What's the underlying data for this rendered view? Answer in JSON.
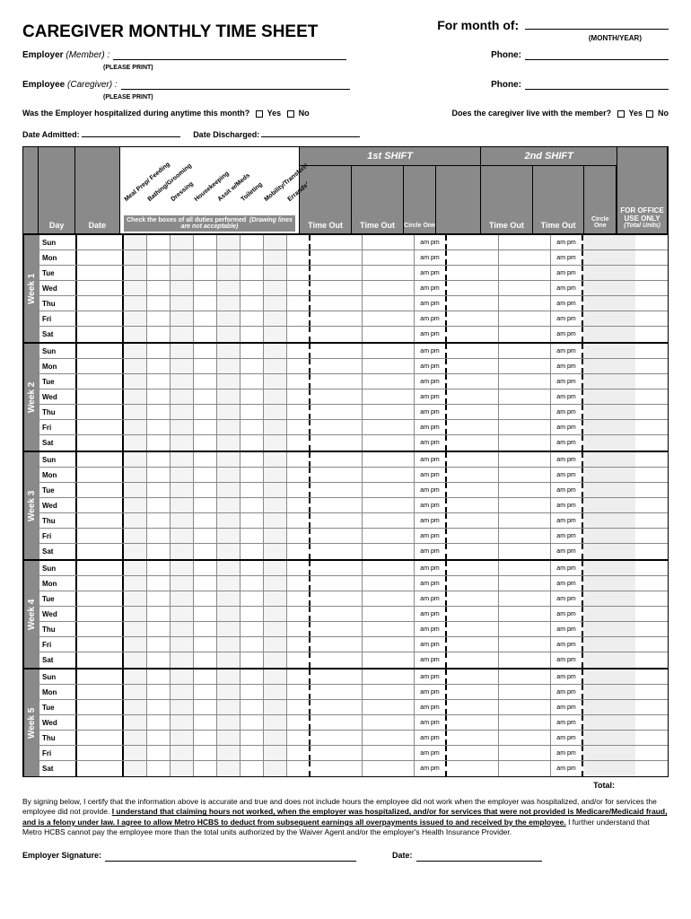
{
  "title": "CAREGIVER MONTHLY TIME SHEET",
  "for_month_label": "For month of:",
  "month_hint": "(MONTH/YEAR)",
  "employer_label": "Employer",
  "employer_role": "(Member) :",
  "employee_label": "Employee",
  "employee_role": "(Caregiver) :",
  "phone_label": "Phone:",
  "print_hint": "(PLEASE PRINT)",
  "hospitalized_q": "Was the Employer hospitalized during anytime this month?",
  "live_q": "Does the caregiver live with the member?",
  "yes": "Yes",
  "no": "No",
  "date_admitted": "Date Admitted:",
  "date_discharged": "Date Discharged:",
  "duties": [
    "Meal Prep/ Feeding",
    "Bathing/Grooming",
    "Dressing",
    "Housekeeping",
    "Assit w/Meds",
    "Toileting",
    "Mobility/Transferring",
    "Errands/ Shopping"
  ],
  "duties_note_1": "Check the boxes of all duties performed",
  "duties_note_2": "(Drawing lines are not acceptable)",
  "col_day": "Day",
  "col_date": "Date",
  "shift1": "1st SHIFT",
  "shift2": "2nd SHIFT",
  "col_timeout": "Time Out",
  "col_circle": "Circle One",
  "col_office_1": "FOR OFFICE USE ONLY",
  "col_office_2": "(Total Units)",
  "ampm": "am   pm",
  "weeks": [
    "Week  1",
    "Week  2",
    "Week  3",
    "Week  4",
    "Week  5"
  ],
  "days": [
    "Sun",
    "Mon",
    "Tue",
    "Wed",
    "Thu",
    "Fri",
    "Sat"
  ],
  "total_label": "Total:",
  "cert_text_1": "By signing below, I certify that the information above is accurate and true and does not include hours the employee did not work when the employer was hospitalized, and/or for services the employee did not provide. ",
  "cert_text_u": "I understand that claiming hours not worked, when the employer was hospitalized, and/or for services that were not provided is Medicare/Medicaid fraud, and is a felony under law. I agree to allow Metro HCBS to deduct from subsequent earnings all overpayments issued to and received by the employee.",
  "cert_text_2": " I further understand that Metro HCBS cannot pay the employee more than the total units authorized by the Waiver Agent and/or the employer's Health Insurance Provider.",
  "sig_employer": "Employer Signature:",
  "sig_date": "Date:"
}
